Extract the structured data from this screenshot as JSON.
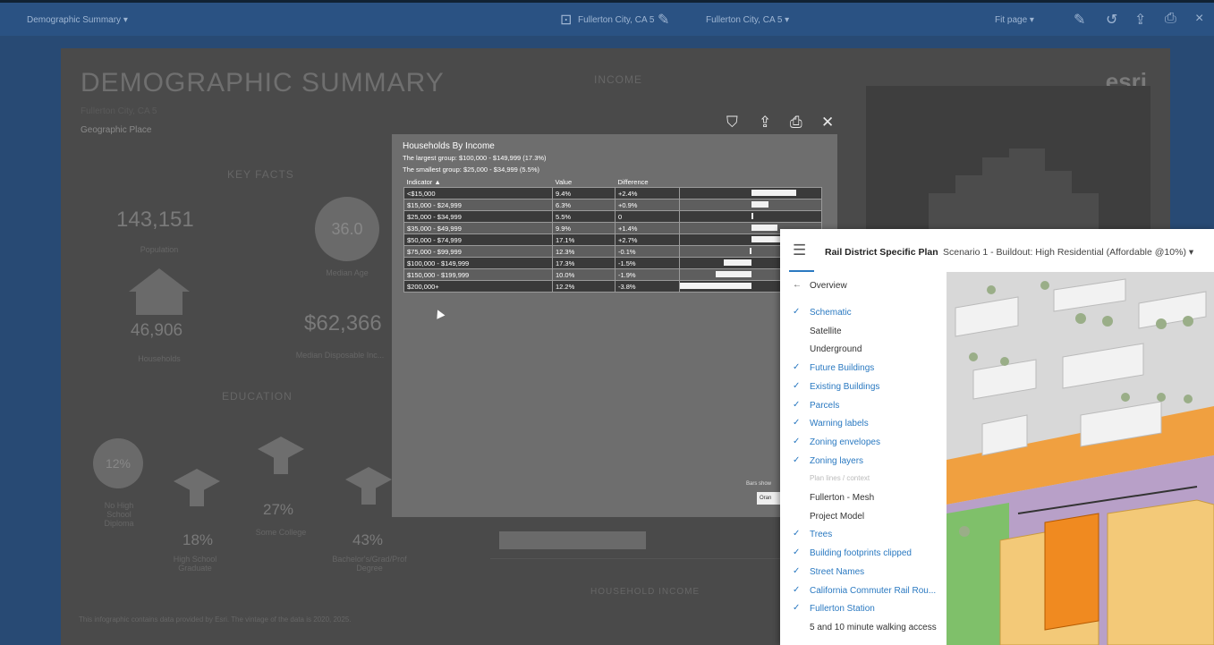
{
  "topbar": {
    "report_menu": "Demographic Summary ▾",
    "location_left": "Fullerton City, CA 5",
    "location_right": "Fullerton City, CA 5 ▾",
    "fit_page": "Fit page ▾"
  },
  "report": {
    "title": "DEMOGRAPHIC SUMMARY",
    "subtitle": "Fullerton City, CA 5",
    "area": "Geographic Place",
    "logo": "esri",
    "income_heading": "INCOME",
    "key_facts_heading": "KEY FACTS",
    "population_value": "143,151",
    "population_label": "Population",
    "median_age_value": "36.0",
    "median_age_label": "Median Age",
    "households_value": "46,906",
    "households_label": "Households",
    "disposable_income_value": "$62,366",
    "disposable_income_label": "Median Disposable Inc...",
    "education_heading": "EDUCATION",
    "no_hs_value": "12%",
    "no_hs_label": "No High School Diploma",
    "hs_value": "18%",
    "hs_label": "High School Graduate",
    "some_college_value": "27%",
    "some_college_label": "Some College",
    "bachelors_value": "43%",
    "bachelors_label": "Bachelor's/Grad/Prof Degree",
    "household_income_axis": "HOUSEHOLD INCOME",
    "footer": "This infographic contains data provided by Esri. The vintage of the data is 2020, 2025."
  },
  "popup": {
    "title": "Households By Income",
    "largest": "The largest group: $100,000 - $149,999 (17.3%)",
    "smallest": "The smallest group: $25,000 - $34,999 (5.5%)",
    "columns": [
      "Indicator ▲",
      "Value",
      "Difference"
    ],
    "rows": [
      {
        "indicator": "<$15,000",
        "value": "9.4%",
        "difference": "+2.4%",
        "diff_num": 2.4
      },
      {
        "indicator": "$15,000 - $24,999",
        "value": "6.3%",
        "difference": "+0.9%",
        "diff_num": 0.9
      },
      {
        "indicator": "$25,000 - $34,999",
        "value": "5.5%",
        "difference": "0",
        "diff_num": 0
      },
      {
        "indicator": "$35,000 - $49,999",
        "value": "9.9%",
        "difference": "+1.4%",
        "diff_num": 1.4
      },
      {
        "indicator": "$50,000 - $74,999",
        "value": "17.1%",
        "difference": "+2.7%",
        "diff_num": 2.7
      },
      {
        "indicator": "$75,000 - $99,999",
        "value": "12.3%",
        "difference": "-0.1%",
        "diff_num": -0.1
      },
      {
        "indicator": "$100,000 - $149,999",
        "value": "17.3%",
        "difference": "-1.5%",
        "diff_num": -1.5
      },
      {
        "indicator": "$150,000 - $199,999",
        "value": "10.0%",
        "difference": "-1.9%",
        "diff_num": -1.9
      },
      {
        "indicator": "$200,000+",
        "value": "12.2%",
        "difference": "-3.8%",
        "diff_num": -3.8
      }
    ],
    "bars_show": "Bars show",
    "legend_value": "Oran"
  },
  "app": {
    "title": "Rail District Specific Plan",
    "scenario": "Scenario 1 - Buildout: High Residential (Affordable @10%) ▾",
    "back_label": "Overview",
    "layers": [
      {
        "label": "Schematic",
        "checked": true,
        "kind": "blue"
      },
      {
        "label": "Satellite",
        "checked": false,
        "kind": "gray"
      },
      {
        "label": "Underground",
        "checked": false,
        "kind": "gray"
      },
      {
        "label": "Future Buildings",
        "checked": true,
        "kind": "blue"
      },
      {
        "label": "Existing Buildings",
        "checked": true,
        "kind": "blue"
      },
      {
        "label": "Parcels",
        "checked": true,
        "kind": "blue"
      },
      {
        "label": "Warning labels",
        "checked": true,
        "kind": "blue"
      },
      {
        "label": "Zoning envelopes",
        "checked": true,
        "kind": "blue"
      },
      {
        "label": "Zoning layers",
        "checked": true,
        "kind": "blue"
      },
      {
        "label": "Plan lines / context",
        "checked": false,
        "kind": "grp"
      },
      {
        "label": "Fullerton - Mesh",
        "checked": false,
        "kind": "gray"
      },
      {
        "label": "Project Model",
        "checked": false,
        "kind": "gray"
      },
      {
        "label": "Trees",
        "checked": true,
        "kind": "blue"
      },
      {
        "label": "Building footprints clipped",
        "checked": true,
        "kind": "blue"
      },
      {
        "label": "Street Names",
        "checked": true,
        "kind": "blue"
      },
      {
        "label": "California Commuter Rail Rou...",
        "checked": true,
        "kind": "blue"
      },
      {
        "label": "Fullerton Station",
        "checked": true,
        "kind": "blue"
      },
      {
        "label": "5 and 10 minute walking access",
        "checked": false,
        "kind": "gray"
      }
    ]
  }
}
